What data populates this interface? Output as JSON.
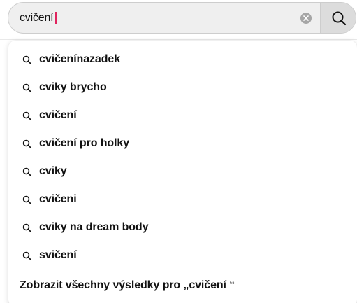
{
  "search": {
    "value": "cvičení",
    "clear_icon": "clear-circle-icon",
    "submit_icon": "search-icon"
  },
  "suggestions": [
    {
      "label": "cvičenínazadek",
      "icon": "search-icon"
    },
    {
      "label": "cviky brycho",
      "icon": "search-icon"
    },
    {
      "label": "cvičení",
      "icon": "search-icon"
    },
    {
      "label": "cvičení pro holky",
      "icon": "search-icon"
    },
    {
      "label": "cviky",
      "icon": "search-icon"
    },
    {
      "label": "cvičeni",
      "icon": "search-icon"
    },
    {
      "label": "cviky na dream body",
      "icon": "search-icon"
    },
    {
      "label": "svičení",
      "icon": "search-icon"
    }
  ],
  "show_all": {
    "label": "Zobrazit všechny výsledky pro „cvičení “"
  },
  "colors": {
    "caret": "#e0245e",
    "input_bg": "#efefef",
    "search_button_bg": "#dcdcdc"
  }
}
